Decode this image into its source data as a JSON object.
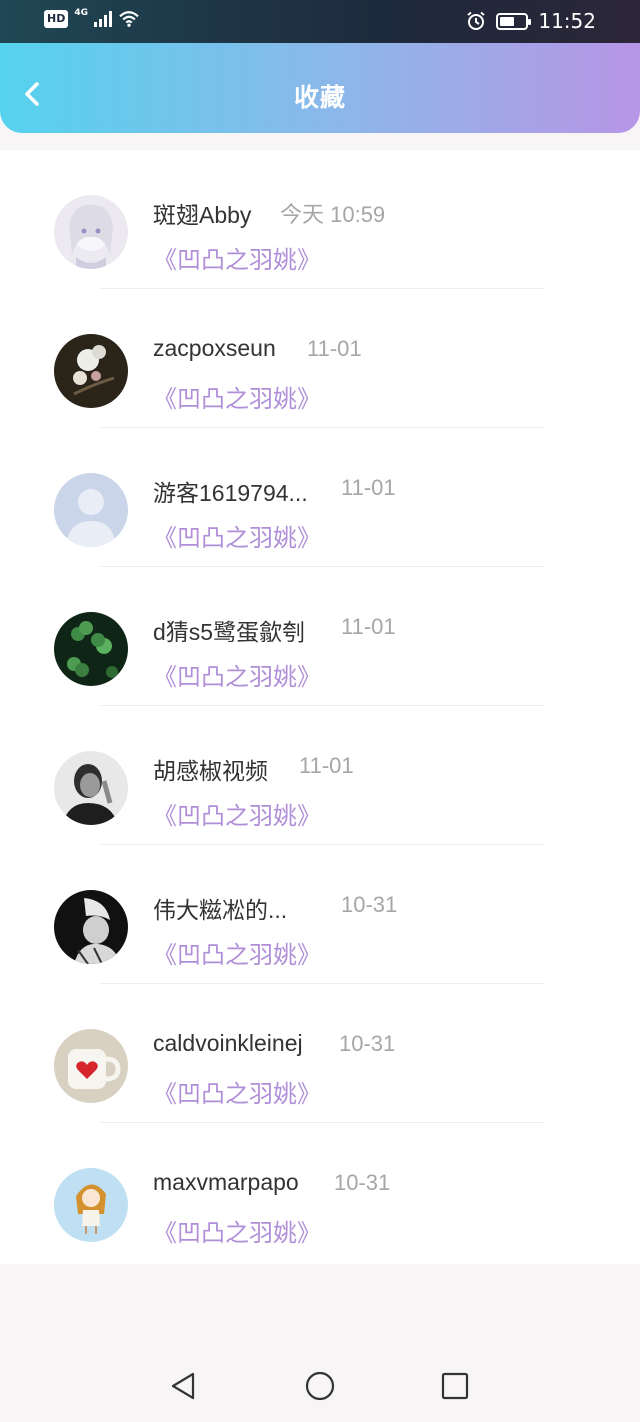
{
  "status_bar": {
    "hd_label": "HD",
    "network_label": "4G",
    "clock": "11:52",
    "icons": [
      "hd-icon",
      "signal-icon",
      "wifi-icon",
      "alarm-icon",
      "battery-icon"
    ]
  },
  "header": {
    "title": "收藏",
    "back_icon": "chevron-left-icon"
  },
  "items": [
    {
      "name": "斑翅Abby",
      "time": "今天 10:59",
      "work": "《凹凸之羽姚》",
      "avatar": "anime-girl-avatar",
      "avatar_color": "#e9e6ee"
    },
    {
      "name": "zacpoxseun",
      "time": "11-01",
      "work": "《凹凸之羽姚》",
      "avatar": "flower-avatar",
      "avatar_color": "#2b2418"
    },
    {
      "name": "游客1619794...",
      "time": "11-01",
      "work": "《凹凸之羽姚》",
      "avatar": "default-user-avatar",
      "avatar_color": "#cdd6ea"
    },
    {
      "name": "d猜s5鹭蛋歙刳",
      "time": "11-01",
      "work": "《凹凸之羽姚》",
      "avatar": "clover-avatar",
      "avatar_color": "#13301c"
    },
    {
      "name": "胡感椒视频",
      "time": "11-01",
      "work": "《凹凸之羽姚》",
      "avatar": "man-portrait-avatar",
      "avatar_color": "#3a3a3a"
    },
    {
      "name": "伟大糍凇的...",
      "time": "10-31",
      "work": "《凹凸之羽姚》",
      "avatar": "bw-portrait-avatar",
      "avatar_color": "#1a1a1a"
    },
    {
      "name": "caldvoinkleinej",
      "time": "10-31",
      "work": "《凹凸之羽姚》",
      "avatar": "heart-mug-avatar",
      "avatar_color": "#d9d2c4"
    },
    {
      "name": "maxvmarpapo",
      "time": "10-31",
      "work": "《凹凸之羽姚》",
      "avatar": "cartoon-girl-avatar",
      "avatar_color": "#bfe0f3"
    }
  ],
  "nav_bar": {
    "icons": [
      "back-triangle-icon",
      "home-circle-icon",
      "recents-square-icon"
    ]
  },
  "colors": {
    "header_gradient_start": "#55d2ee",
    "header_gradient_end": "#b795e6",
    "work_title": "#b08fd8",
    "time_gray": "#a6a6a6"
  }
}
